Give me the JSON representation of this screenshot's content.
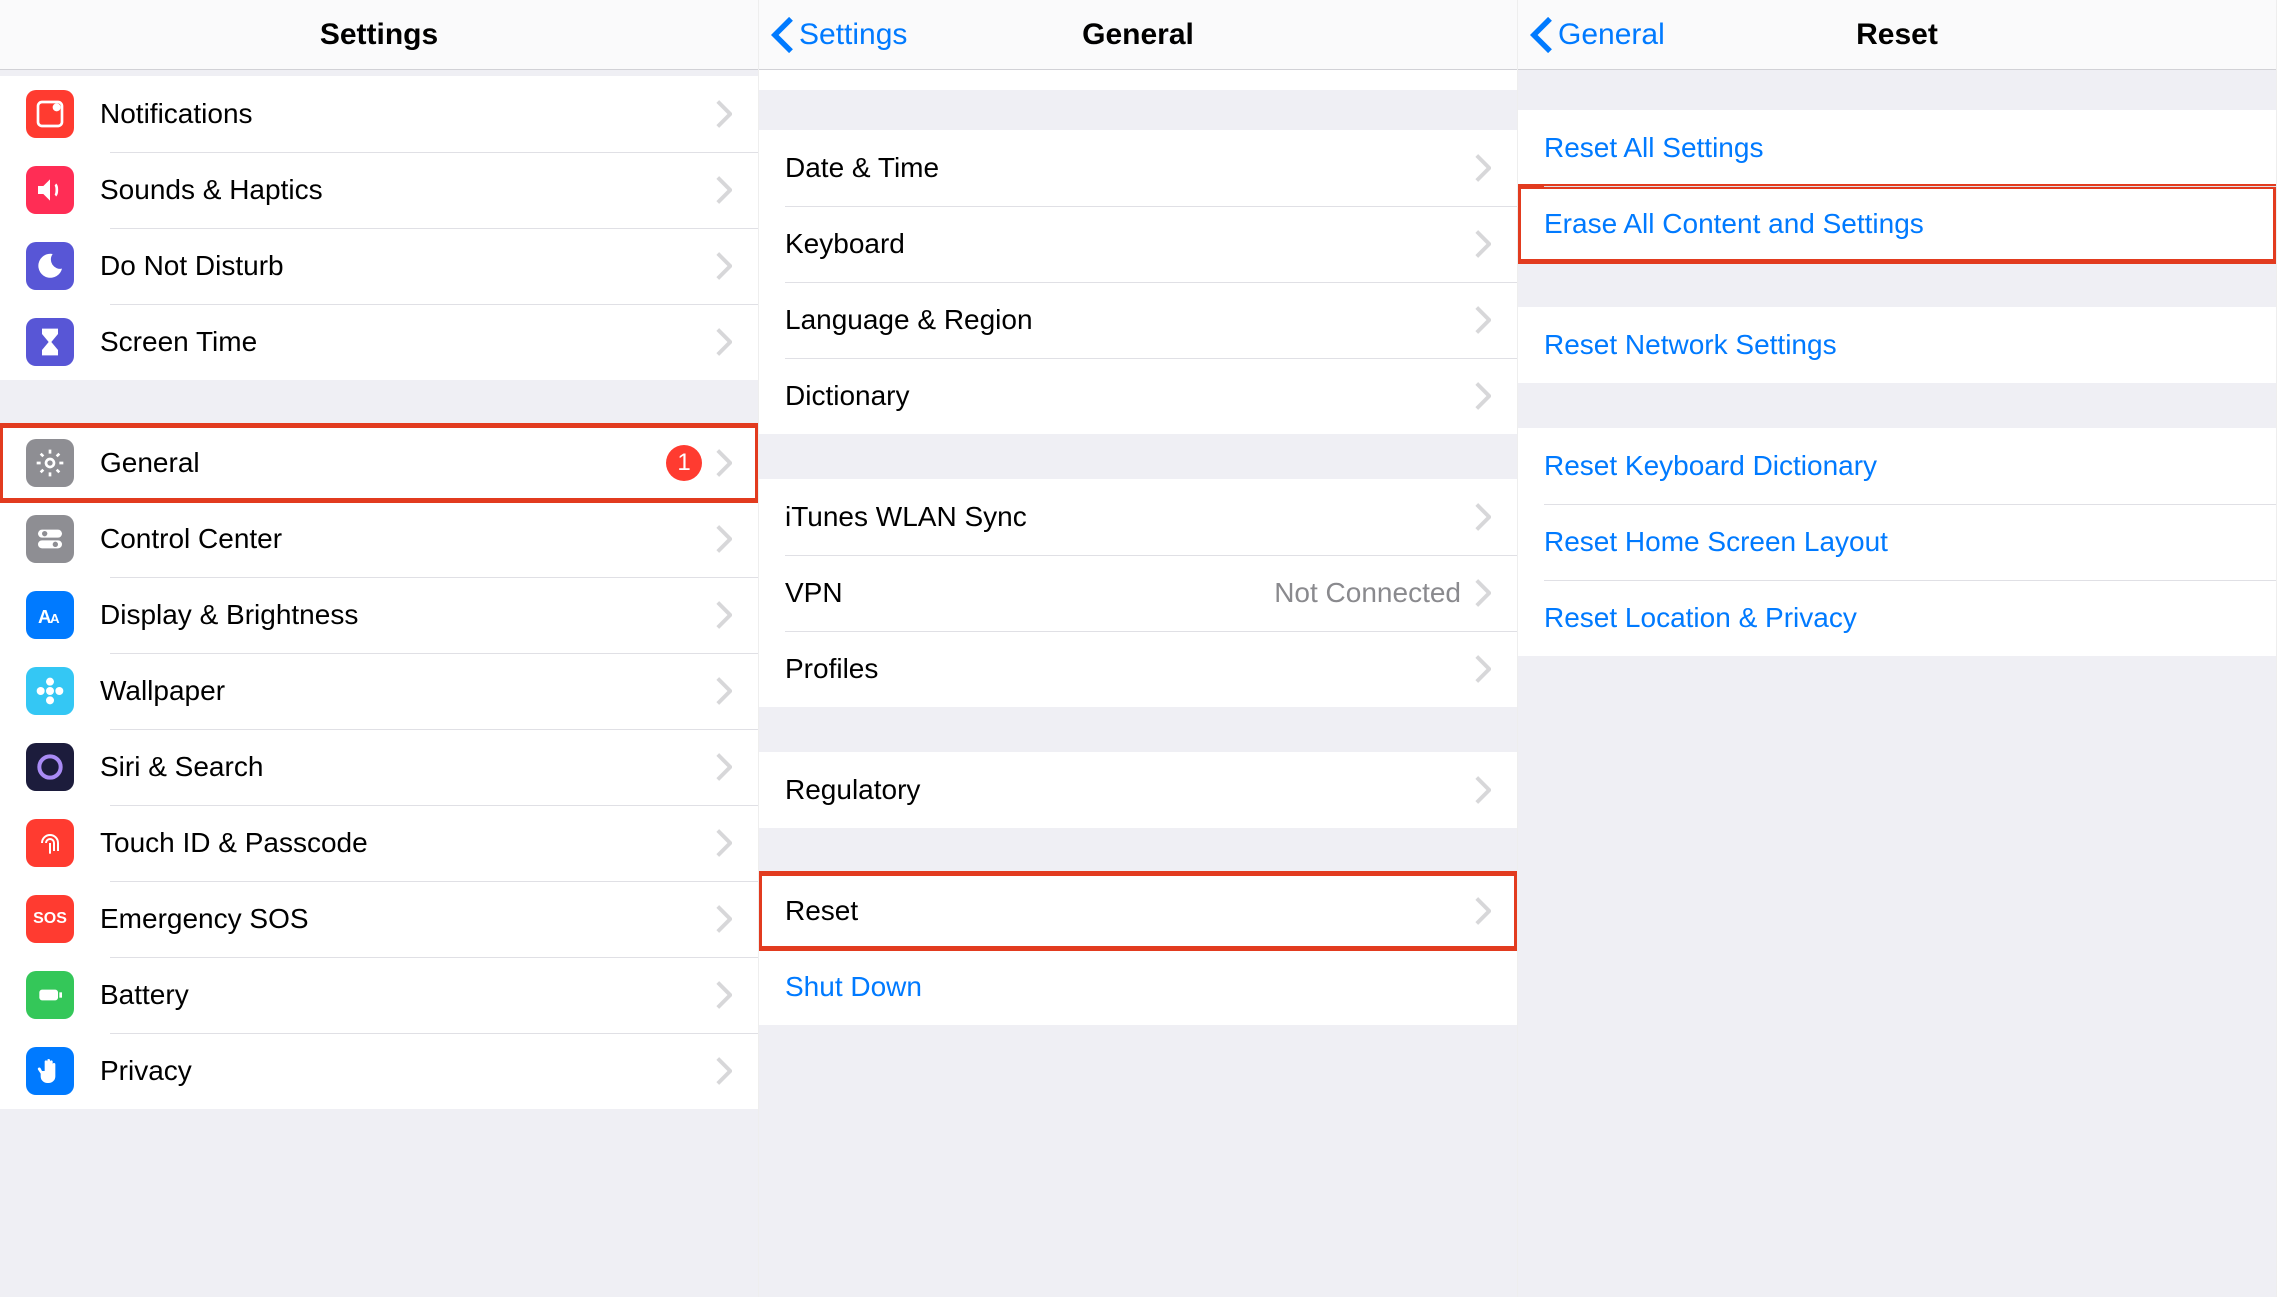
{
  "settings": {
    "header_title": "Settings",
    "rows": [
      {
        "label": "Notifications",
        "icon": "notifications"
      },
      {
        "label": "Sounds & Haptics",
        "icon": "sounds"
      },
      {
        "label": "Do Not Disturb",
        "icon": "moon"
      },
      {
        "label": "Screen Time",
        "icon": "screentime"
      }
    ],
    "rows2": [
      {
        "label": "General",
        "icon": "general",
        "badge": "1",
        "highlight": true
      },
      {
        "label": "Control Center",
        "icon": "control"
      },
      {
        "label": "Display & Brightness",
        "icon": "display"
      },
      {
        "label": "Wallpaper",
        "icon": "wallpaper"
      },
      {
        "label": "Siri & Search",
        "icon": "siri"
      },
      {
        "label": "Touch ID & Passcode",
        "icon": "touchid"
      },
      {
        "label": "Emergency SOS",
        "icon": "sos"
      },
      {
        "label": "Battery",
        "icon": "battery"
      },
      {
        "label": "Privacy",
        "icon": "privacy"
      }
    ]
  },
  "general": {
    "back_label": "Settings",
    "header_title": "General",
    "group1": [
      {
        "label": "Date & Time"
      },
      {
        "label": "Keyboard"
      },
      {
        "label": "Language & Region"
      },
      {
        "label": "Dictionary"
      }
    ],
    "group2": [
      {
        "label": "iTunes WLAN Sync"
      },
      {
        "label": "VPN",
        "value": "Not Connected"
      },
      {
        "label": "Profiles"
      }
    ],
    "group3": [
      {
        "label": "Regulatory"
      }
    ],
    "group4": [
      {
        "label": "Reset",
        "highlight": true
      },
      {
        "label": "Shut Down",
        "blue": true,
        "no_chevron": true
      }
    ]
  },
  "reset": {
    "back_label": "General",
    "header_title": "Reset",
    "group1": [
      {
        "label": "Reset All Settings"
      },
      {
        "label": "Erase All Content and Settings",
        "highlight": true
      }
    ],
    "group2": [
      {
        "label": "Reset Network Settings"
      }
    ],
    "group3": [
      {
        "label": "Reset Keyboard Dictionary"
      },
      {
        "label": "Reset Home Screen Layout"
      },
      {
        "label": "Reset Location & Privacy"
      }
    ]
  }
}
